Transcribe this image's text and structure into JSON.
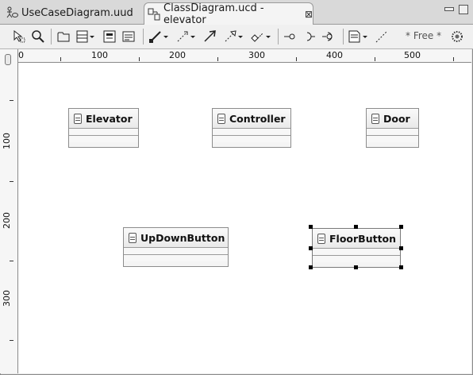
{
  "tabs": [
    {
      "label": "UseCaseDiagram.uud",
      "active": false
    },
    {
      "label": "ClassDiagram.ucd - elevator",
      "active": true,
      "close": "⊠"
    }
  ],
  "toolbar": {
    "icons": [
      "select-icon",
      "zoom-icon",
      "package-icon",
      "class-icon",
      "interface-icon",
      "enum-icon",
      "association-icon",
      "dependency-icon",
      "generalization-icon",
      "realization-icon",
      "aggregation-icon",
      "provided-interface-icon",
      "required-interface-icon",
      "port-icon",
      "note-icon",
      "note-link-icon",
      "palette-icon"
    ],
    "free_label": "* Free *"
  },
  "ruler": {
    "horizontal": [
      "0",
      "100",
      "200",
      "300",
      "400",
      "500"
    ],
    "vertical": [
      "100",
      "200",
      "300"
    ]
  },
  "classes": [
    {
      "name": "Elevator",
      "selected": false
    },
    {
      "name": "Controller",
      "selected": false
    },
    {
      "name": "Door",
      "selected": false
    },
    {
      "name": "UpDownButton",
      "selected": false
    },
    {
      "name": "FloorButton",
      "selected": true
    }
  ]
}
